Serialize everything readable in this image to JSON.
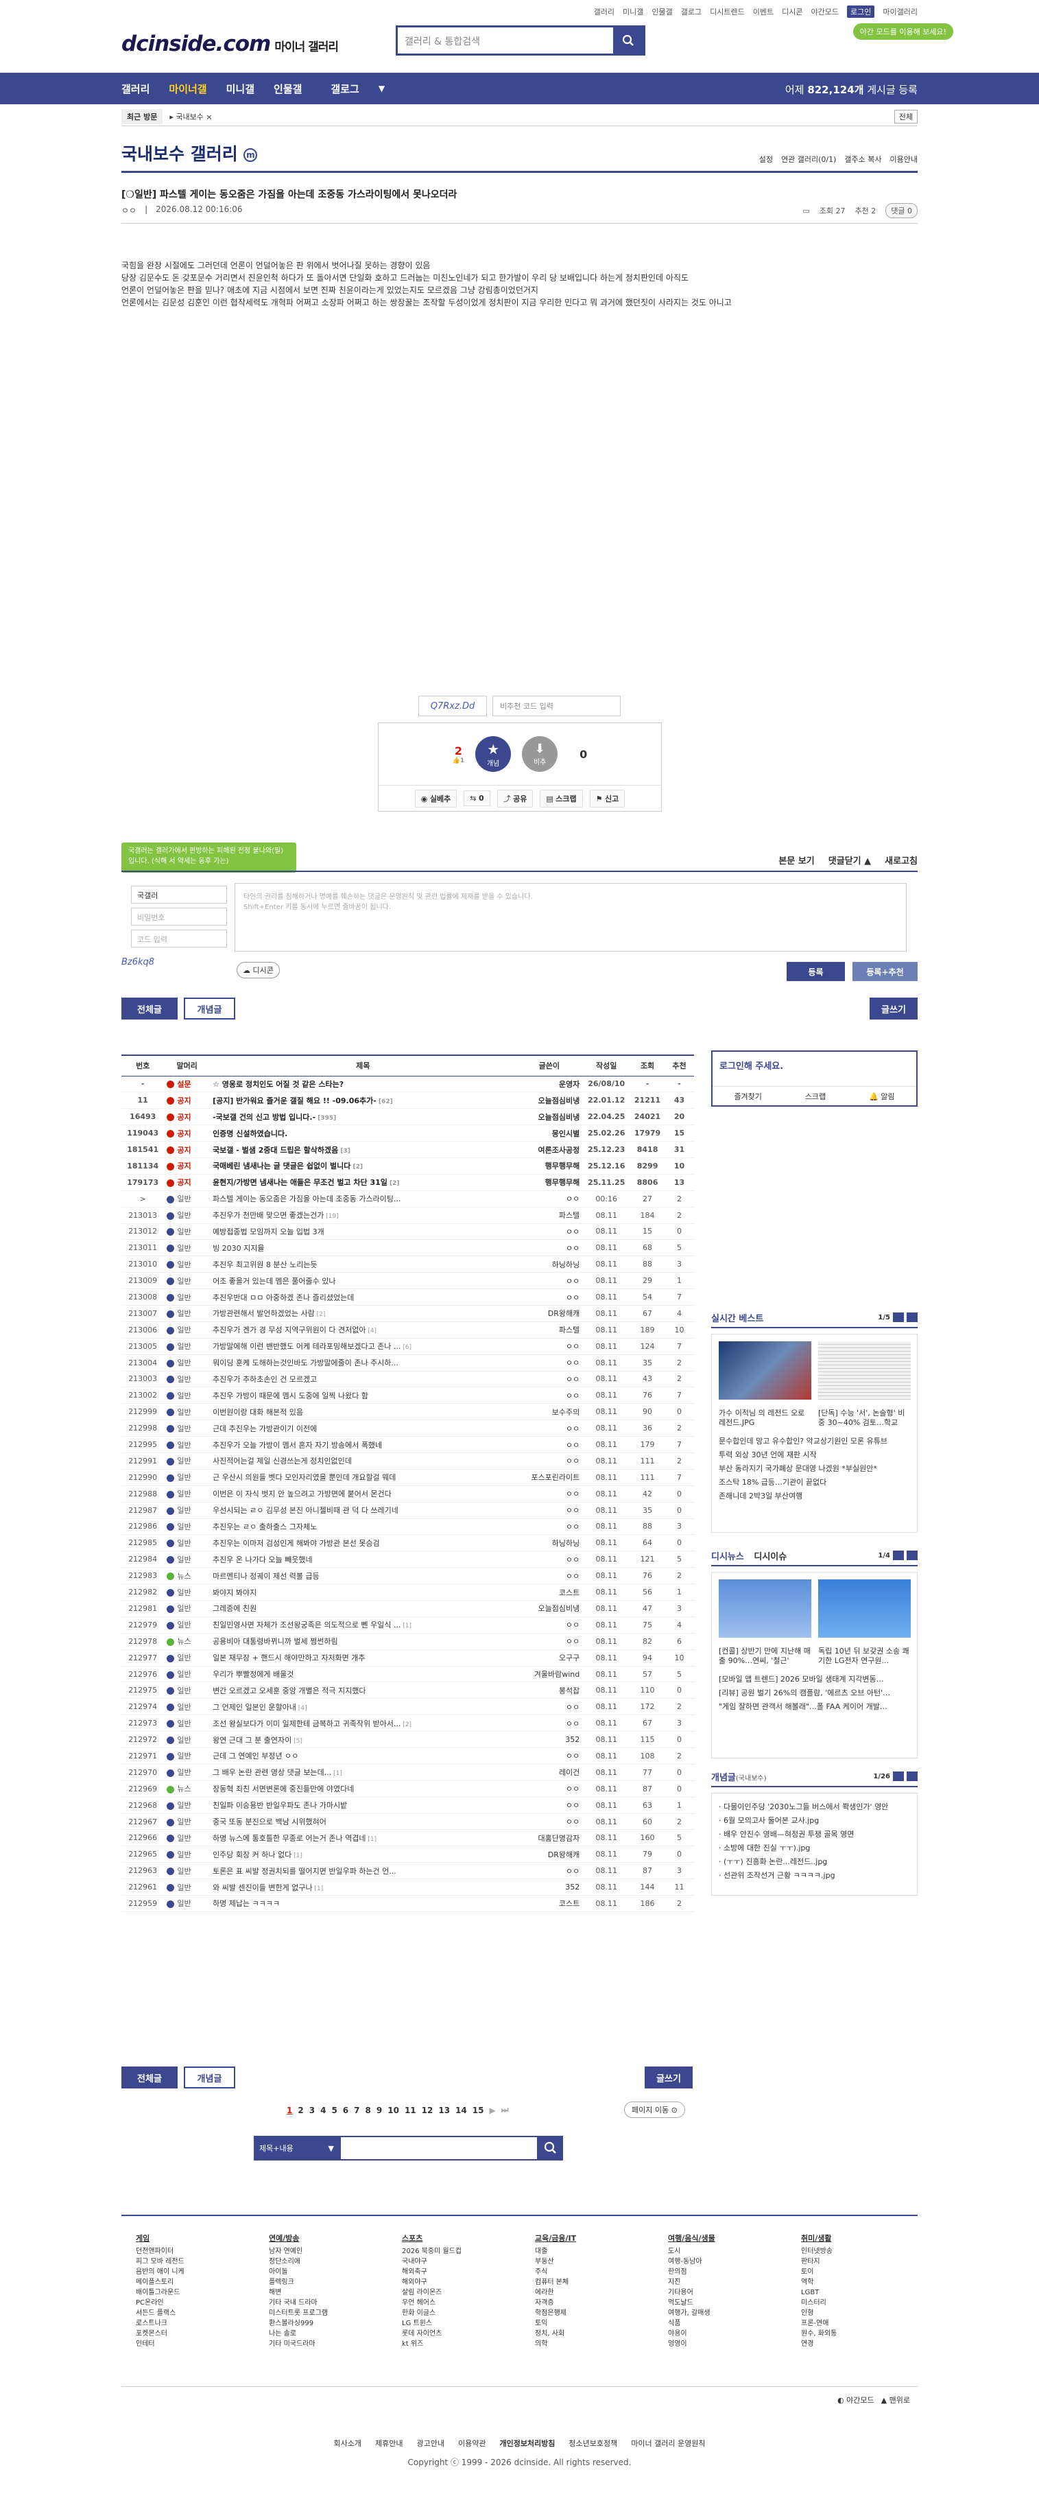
{
  "topmenu": [
    "갤러리",
    "미니갤",
    "인물갤",
    "갤로그",
    "디시트렌드",
    "이벤트",
    "디시콘",
    "야간모드",
    "로그인",
    "마이갤러리"
  ],
  "logo": {
    "brand": "dcinside.com",
    "sub": "마이너 갤러리"
  },
  "search": {
    "placeholder": "갤러리 & 통합검색"
  },
  "darkmode_notice": "야간 모드를 이용해 보세요!",
  "gnb": {
    "items": [
      "갤러리",
      "마이너갤",
      "미니갤",
      "인물갤",
      "갤로그"
    ],
    "count_prefix": "어제",
    "count": "822,124개",
    "count_suffix": "게시글 등록"
  },
  "recent": {
    "label": "최근 방문",
    "item": "국내보수",
    "expand": "전체"
  },
  "gallery": {
    "title": "국내보수 갤러리",
    "minor_mark": "m",
    "options": [
      "설정",
      "연관 갤러리(0/1)",
      "갤주소 복사",
      "이용안내"
    ]
  },
  "post": {
    "title": "[❍일반] 파스텔 게이는 동오줌은 가짐을 아는데 조중동 가스라이팅에서 못나오더라",
    "author": "ㅇㅇ",
    "date": "2026.08.12 00:16:06",
    "views": "조회 27",
    "recommend": "추천 2",
    "comments": "댓글 0",
    "body": [
      "국힘을 완장 시절에도 그러던데 언론이 언덜어놓은 판 위에서 벗어나질 못하는 경향이 있음",
      "당장 김문수도 돈 갖포문수 거리면서 진윤인척 하다가 또 돌아서면 단일화 호하고 드러눕는 미친노인네가 되고 한가발이 우리 당 보배입니다 하는게 정치판인데 아직도",
      "언론이 언덜어놓은 판을 믿나? 애초에 지금 시점에서 보면 진짜 친윤이라는게 있었는지도 모르겠음 그냥 강림총이었던거지",
      "언론에서는 김문성 김훈인 이런 협작세력도 개혁파 어쩌고 소장파 어쩌고 하는 쌍장꿀는 조작할 두성이었게 정치판이 지금 우리한 민다고 뭐 과거에 했던짓이 사라지는 것도 아니고"
    ]
  },
  "captcha": {
    "text": "Q7Rxz.Dd",
    "placeholder": "비추천 코드 입력"
  },
  "rec": {
    "up": "2",
    "up_fix": "1",
    "up_label": "개념",
    "down_label": "비추",
    "down": "0",
    "bar": [
      "실베추",
      "공유",
      "스크랩",
      "신고"
    ],
    "share_count": "0"
  },
  "tooltip": "국갤러는 갤러가에서 편방하는 피해된 전청 불나와(필)입니다. (식해 서 약세는 동후 가는)",
  "comment": {
    "tabs": [
      "본문 보기",
      "댓글닫기 ▲",
      "새로고침"
    ],
    "name": "국갤러",
    "pw": "비밀번호",
    "cap": "코드 입력",
    "placeholder1": "타인의 권리를 침해하거나 명예를 훼손하는 댓글은 운영원칙 및 관련 법률에 제재를 받을 수 있습니다.",
    "placeholder2": "Shift+Enter 키를 동시에 누르면 줄바꿈이 됩니다.",
    "captcha": "Bz6kq8",
    "dccon": "디시콘",
    "submit": "등록",
    "submit2": "등록+추천"
  },
  "listtabs": {
    "all": "전체글",
    "concept": "개념글",
    "write": "글쓰기"
  },
  "table": {
    "headers": [
      "번호",
      "말머리",
      "제목",
      "글쓴이",
      "작성일",
      "조회",
      "추천"
    ],
    "rows": [
      [
        "-",
        "설문",
        "☆ 영웅로 정치인도 어질 것 같은 스타는?",
        "운영자",
        "26/08/10",
        "-",
        "-",
        "notice",
        "red"
      ],
      [
        "11",
        "공지",
        "[공지] 반가워요 즐거운 갤질 해요 !! -09.06추가-",
        "오늘점심비냉",
        "22.01.12",
        "21211",
        "43",
        "notice",
        "red",
        "62"
      ],
      [
        "16493",
        "공지",
        "-국보갤 건의 신고 방법 입니다.-",
        "오늘점심비냉",
        "22.04.25",
        "24021",
        "20",
        "notice",
        "red",
        "395"
      ],
      [
        "119043",
        "공지",
        "인증명 신설하였습니다.",
        "몽인시별",
        "25.02.26",
        "17979",
        "15",
        "notice",
        "red",
        ""
      ],
      [
        "181541",
        "공지",
        "국보갤 - 벌샘 2중대 드립은 할삭하겠음",
        "여론조사공정",
        "25.12.23",
        "8418",
        "31",
        "notice",
        "red",
        "3"
      ],
      [
        "181134",
        "공지",
        "국매베린 냄새나는 글 댓글은 쉽없이 벌니다",
        "행무행무해",
        "25.12.16",
        "8299",
        "10",
        "notice",
        "red",
        "2"
      ],
      [
        "179173",
        "공지",
        "윤현지/가방면 냄새나는 애들은 무조건 벌고 차단 31일",
        "행무행무해",
        "25.11.25",
        "8806",
        "13",
        "notice",
        "red",
        "2"
      ],
      [
        ">",
        "일반",
        "파스텔 게이는 동오줌은 가짐을 아는데 조중동 가스라이팅...",
        "ㅇㅇ",
        "00:16",
        "27",
        "2",
        "",
        "blue",
        ""
      ],
      [
        "213013",
        "일반",
        "추진우가 천만배 맞으면 좋겠는건가",
        "파스텔",
        "08.11",
        "184",
        "2",
        "",
        "blue",
        "19"
      ],
      [
        "213012",
        "일반",
        "예방접종법 모임까지 오늘 입법 3개",
        "ㅇㅇ",
        "08.11",
        "15",
        "0",
        "",
        "blue",
        ""
      ],
      [
        "213011",
        "일반",
        "빙 2030 지지율",
        "ㅇㅇ",
        "08.11",
        "68",
        "5",
        "",
        "blue",
        ""
      ],
      [
        "213010",
        "일반",
        "추진우 최고위원 8 분산 노리는듯",
        "하닝하닝",
        "08.11",
        "88",
        "3",
        "",
        "blue",
        ""
      ],
      [
        "213009",
        "일반",
        "어조 좋을거 있는데 멤은 풀어줄수 있나",
        "ㅇㅇ",
        "08.11",
        "29",
        "1",
        "",
        "blue",
        ""
      ],
      [
        "213008",
        "일반",
        "추진우반대 ㅁㅁ 아중하겠 존나 즐리셨었는데",
        "ㅇㅇ",
        "08.11",
        "54",
        "7",
        "",
        "blue",
        ""
      ],
      [
        "213007",
        "일반",
        "가방관련해서 발언하겠었는 사람",
        "DR왕해캐",
        "08.11",
        "67",
        "4",
        "",
        "blue",
        "2"
      ],
      [
        "213006",
        "일반",
        "추진우가 겐가 경 무성 지역구위원이 다 견저없아",
        "파스텔",
        "08.11",
        "189",
        "10",
        "",
        "blue",
        "4"
      ],
      [
        "213005",
        "일반",
        "가방말에해 이런 밴반했도 어케 테라포밍해보겠다고 존나 ...",
        "ㅇㅇ",
        "08.11",
        "124",
        "7",
        "",
        "blue",
        "6"
      ],
      [
        "213004",
        "일반",
        "뭐이딩 훈케 도해하는것인바도 가방말에줄이 존나 주시하...",
        "ㅇㅇ",
        "08.11",
        "35",
        "2",
        "",
        "blue",
        ""
      ],
      [
        "213003",
        "일반",
        "추진우가 추하초손인 건 모르겠고",
        "ㅇㅇ",
        "08.11",
        "43",
        "2",
        "",
        "blue",
        ""
      ],
      [
        "213002",
        "일반",
        "추진우 가방이 때문에 멤시 도중에 일찍 나왔다 함",
        "ㅇㅇ",
        "08.11",
        "76",
        "7",
        "",
        "blue",
        ""
      ],
      [
        "212999",
        "일반",
        "이번원이랑 대화 해본적 있음",
        "보수주의",
        "08.11",
        "90",
        "0",
        "",
        "blue",
        ""
      ],
      [
        "212998",
        "일반",
        "근데 추진우는 가방관이기 이전에",
        "ㅇㅇ",
        "08.11",
        "36",
        "2",
        "",
        "blue",
        ""
      ],
      [
        "212995",
        "일반",
        "추진우가 오늘 가방이 멤서 혼자 자기 방송에서 폭했네",
        "ㅇㅇ",
        "08.11",
        "179",
        "7",
        "",
        "blue",
        ""
      ],
      [
        "212991",
        "일반",
        "사진적어는걸 제일 신경쓰는게 정치인없인데",
        "ㅇㅇ",
        "08.11",
        "111",
        "2",
        "",
        "blue",
        ""
      ],
      [
        "212990",
        "일반",
        "근 우산시 의원들 벳다 모인자리였을 뿐인데 개요할걸 웨데",
        "포스포린라이트",
        "08.11",
        "111",
        "7",
        "",
        "blue",
        ""
      ],
      [
        "212988",
        "일반",
        "이번은 이 자식 벗지 안 높으려고 가방면에 붙어서 몬건다",
        "ㅇㅇ",
        "08.11",
        "42",
        "0",
        "",
        "blue",
        ""
      ],
      [
        "212987",
        "일반",
        "우선시되는 ㄹㅇ 김무성 본진 아니젤비때 관 덕 다 쓰레기네",
        "ㅇㅇ",
        "08.11",
        "35",
        "0",
        "",
        "blue",
        ""
      ],
      [
        "212986",
        "일반",
        "추진우는 ㄹㅇ 출하출스 그자체노",
        "ㅇㅇ",
        "08.11",
        "88",
        "3",
        "",
        "blue",
        ""
      ],
      [
        "212985",
        "일반",
        "추진우는 이마저 검성인게 해봐야 가방관 본선 못승검",
        "하닝하닝",
        "08.11",
        "64",
        "0",
        "",
        "blue",
        ""
      ],
      [
        "212984",
        "일반",
        "추진우 온 나가다 오늘 빼웃했네",
        "ㅇㅇ",
        "08.11",
        "121",
        "5",
        "",
        "blue",
        ""
      ],
      [
        "212983",
        "뉴스",
        "마르멘티나 정궤이 제선 력볼 급등",
        "ㅇㅇ",
        "08.11",
        "76",
        "2",
        "",
        "green",
        ""
      ],
      [
        "212982",
        "일반",
        "봐야지 봐야지",
        "코스트",
        "08.11",
        "56",
        "1",
        "",
        "blue",
        ""
      ],
      [
        "212981",
        "일반",
        "그레증에 친원",
        "오늘점심비냉",
        "08.11",
        "47",
        "3",
        "",
        "blue",
        ""
      ],
      [
        "212979",
        "일반",
        "친일민영사면 자체가 조선왕궁족은 의도적으로 뻰 우일식 ...",
        "ㅇㅇ",
        "08.11",
        "75",
        "4",
        "",
        "blue",
        "1"
      ],
      [
        "212978",
        "뉴스",
        "공용비아 대통령바뀌니까 벌세 쩡썬하림",
        "ㅇㅇ",
        "08.11",
        "82",
        "6",
        "",
        "green",
        ""
      ],
      [
        "212977",
        "일반",
        "일본 재무장 + 핸드시 해야만하고 자저화면 개추",
        "오구구",
        "08.11",
        "94",
        "10",
        "",
        "blue",
        ""
      ],
      [
        "212976",
        "일반",
        "우리가 뿌빨정에게 배울것",
        "겨울바람wind",
        "08.11",
        "57",
        "5",
        "",
        "blue",
        ""
      ],
      [
        "212975",
        "일반",
        "변간 오르겠고 오세훈 중앙 개별은 적극 지지했다",
        "봉석잡",
        "08.11",
        "110",
        "0",
        "",
        "blue",
        ""
      ],
      [
        "212974",
        "일반",
        "그 언제인 일본인 운할아내",
        "ㅇㅇ",
        "08.11",
        "172",
        "2",
        "",
        "blue",
        "4"
      ],
      [
        "212973",
        "일반",
        "조선 왕실보다가 이미 일제한테 금복하고 귀족작위 받아서...",
        "ㅇㅇ",
        "08.11",
        "67",
        "3",
        "",
        "blue",
        "2"
      ],
      [
        "212972",
        "일반",
        "왕연 근대 그 분 출연자이",
        "352",
        "08.11",
        "115",
        "0",
        "",
        "blue",
        "5"
      ],
      [
        "212971",
        "일반",
        "근데 그 연예인 부정년 ㅇㅇ",
        "ㅇㅇ",
        "08.11",
        "108",
        "2",
        "",
        "blue",
        ""
      ],
      [
        "212970",
        "일반",
        "그 배우 논란 관련 영상 댓글 보는데...",
        "레이건",
        "08.11",
        "77",
        "0",
        "",
        "blue",
        "1"
      ],
      [
        "212969",
        "뉴스",
        "장동혁 죄친 서면변론에 중진들만에 야였다네",
        "ㅇㅇ",
        "08.11",
        "87",
        "0",
        "",
        "green",
        ""
      ],
      [
        "212968",
        "일반",
        "친일파 이승용반 반일우파도 존나 가마시밭",
        "ㅇㅇ",
        "08.11",
        "63",
        "1",
        "",
        "blue",
        ""
      ],
      [
        "212967",
        "일반",
        "중국 또동 분진으로 백남 시위했혀어",
        "ㅇㅇ",
        "08.11",
        "60",
        "2",
        "",
        "blue",
        ""
      ],
      [
        "212966",
        "일반",
        "하명 뉴스에 통호틀한 무종로 어는거 존나 역겹네",
        "대홍단명감자",
        "08.11",
        "160",
        "5",
        "",
        "blue",
        "1"
      ],
      [
        "212965",
        "일반",
        "인주당 회장 커 하나 없다",
        "DR왕해캐",
        "08.11",
        "79",
        "0",
        "",
        "blue",
        "1"
      ],
      [
        "212963",
        "일반",
        "토론은 표 씨발 정권치되를 떨어지면 반일우파 하는건 언...",
        "ㅇㅇ",
        "08.11",
        "87",
        "3",
        "",
        "blue",
        ""
      ],
      [
        "212961",
        "일반",
        "와 씨발 센진이들 변한게 없구나",
        "352",
        "08.11",
        "144",
        "11",
        "",
        "blue",
        "1"
      ],
      [
        "212959",
        "일반",
        "하명 제납는 ㅋㅋㅋㅋ",
        "코스트",
        "08.11",
        "186",
        "2",
        "",
        "blue",
        ""
      ]
    ]
  },
  "login": {
    "title": "로그인해 주세요.",
    "links": [
      "즐겨찾기",
      "스크랩",
      "알림"
    ]
  },
  "best": {
    "title": "실시간 베스트",
    "page": "1/5",
    "items": [
      "가수 이적님 의 레전드 오로 레전드.JPG",
      "[단독] 수능 '서', 논술형' 비중 30~40% 검토…학교",
      "문수합인데 망고 유수합인? 악교상기원인 모론 유튜브",
      "투력 외상 30년 언에 재판 시작",
      "부산 동라지기 국가폐상 문대영 나겠원 *부실원안*",
      "조스탁 18% 급등…기관이 끝없다",
      "존해니데 2박3일 부산여행"
    ]
  },
  "disi": {
    "title1": "디시뉴스",
    "title2": "디시이슈",
    "page": "1/4",
    "items": [
      "[컨콜] 상반기 만에 지난해 매출 90%…연씨, '철근'",
      "독립 10년 뒤 보갖권 소송 쾌기한 LG전자 연구원...",
      "[모바일 앱 트렌드] 2026 모바일 생태계 지각변동…",
      "[리뷰] 공원 벌기 26%의 캠플람, '에르츠 오브 아턴'…",
      "\"게임 잘하면 관객서 해볼래\"…폴 FAA 케이어 개발…"
    ]
  },
  "concept": {
    "title": "개념글",
    "sub": "(국내보수)",
    "page": "1/26",
    "items": [
      "다물이인주당 '2030노그들 버스에서 쫙생인가' 영안",
      "6월 모의고사 둘어본 교사.jpg",
      "배우 안진수 영배—혀정권 투쟁 골목 영면",
      "소방에 대한 진실 ㅜㅜ).jpg",
      "(ㅜㅜ) 진흥화 논란...레전드..jpg",
      "선관위 조작선거 근황 ㅋㅋㅋㅋ.jpg"
    ]
  },
  "pager": {
    "pages": [
      "1",
      "2",
      "3",
      "4",
      "5",
      "6",
      "7",
      "8",
      "9",
      "10",
      "11",
      "12",
      "13",
      "14",
      "15"
    ],
    "jump": "페이지 이동"
  },
  "bottomsearch": {
    "select": "제목+내용"
  },
  "footer": {
    "cols": [
      {
        "title": "게임",
        "items": [
          "던전앤파이터",
          "피그 모바 레전드",
          "음반의 애이 니케",
          "메이플스토리",
          "배이틀그라운드",
          "PC온라인",
          "서든드 플랙스",
          "로스트나크",
          "포켓몬스터",
          "인테터"
        ]
      },
      {
        "title": "연예/방송",
        "items": [
          "남자 연예인",
          "정단소리에",
          "아이돌",
          "플렉링크",
          "해변",
          "기타 국내 드라마",
          "미스터트롯 프로그램",
          "환스볼라싱999",
          "나는 솔로",
          "기타 미국드라마"
        ]
      },
      {
        "title": "스포츠",
        "items": [
          "2026 북중미 월드컵",
          "국내야구",
          "해외축구",
          "해외야구",
          "살림 라이온즈",
          "우언 헤어스",
          "한화 이글스",
          "LG 트윈스",
          "롯데 자이언츠",
          "kt 위즈"
        ]
      },
      {
        "title": "교육/금융/IT",
        "items": [
          "대출",
          "부동산",
          "주식",
          "컴퓨터 본체",
          "에라한",
          "자격증",
          "학점은행제",
          "토익",
          "정치, 사회",
          "의학"
        ]
      },
      {
        "title": "여행/음식/생물",
        "items": [
          "도시",
          "여행-동남아",
          "한의점",
          "지진",
          "기타용어",
          "먹도날드",
          "여행가, 갈매생",
          "식품",
          "야용이",
          "엉영이"
        ]
      },
      {
        "title": "취미/생활",
        "items": [
          "인터넷방송",
          "판타지",
          "토이",
          "역학",
          "LGBT",
          "미스터리",
          "인형",
          "프론-연애",
          "원수, 화외통",
          "연경"
        ]
      }
    ],
    "mode": [
      "야간모드",
      "맨위로"
    ],
    "links": [
      "회사소개",
      "제휴안내",
      "광고안내",
      "이용약관",
      "개인정보처리방침",
      "청소년보호정책",
      "마이너 갤러리 운영원칙"
    ],
    "copyright": "Copyright ⓒ 1999 - 2026 dcinside. All rights reserved."
  },
  "colors": {
    "brand": "#3b4890",
    "accent": "#d31900",
    "green": "#82c341"
  }
}
